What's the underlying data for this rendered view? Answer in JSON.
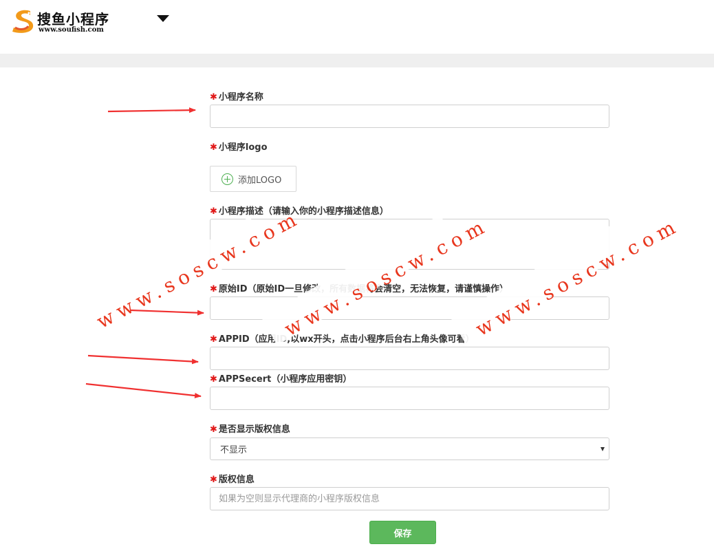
{
  "header": {
    "brand_name": "搜鱼小程序",
    "brand_url": "www.soufish.com"
  },
  "form": {
    "required_mark": "✱",
    "name": {
      "label": "小程序名称",
      "value": ""
    },
    "logo": {
      "label": "小程序logo",
      "button_label": "添加LOGO"
    },
    "description": {
      "label": "小程序描述（请输入你的小程序描述信息）"
    },
    "original_id": {
      "label": "原始ID（原始ID一旦修改，所有数据将会清空，无法恢复，请谨慎操作）"
    },
    "appid": {
      "label": "APPID（应用ID,以wx开头，点击小程序后台右上角头像可看）"
    },
    "appsecret": {
      "label": "APPSecert（小程序应用密钥）"
    },
    "show_copyright": {
      "label": "是否显示版权信息",
      "selected": "不显示"
    },
    "copyright": {
      "label": "版权信息",
      "placeholder": "如果为空则显示代理商的小程序版权信息"
    },
    "save_label": "保存"
  },
  "watermark": {
    "text": "www.soscw.com",
    "color": "#e8361d"
  },
  "colors": {
    "accent_green": "#5cb85c",
    "required_red": "#e01818",
    "arrow_red": "#f03030"
  }
}
